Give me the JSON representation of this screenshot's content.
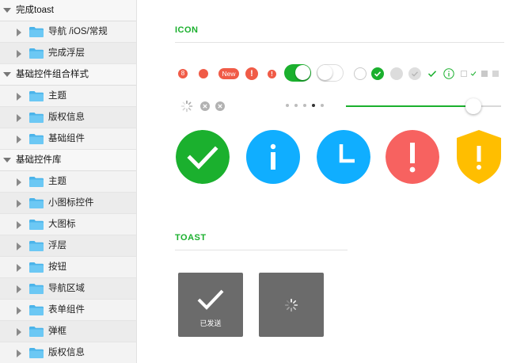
{
  "sidebar": {
    "groups": [
      {
        "label": "完成toast",
        "items": [
          "导航 /iOS/常规",
          "完成浮层"
        ]
      },
      {
        "label": "基础控件组合样式",
        "items": [
          "主题",
          "版权信息",
          "基础组件"
        ]
      },
      {
        "label": "基础控件库",
        "items": [
          "主题",
          "小图标控件",
          "大图标",
          "浮层",
          "按钮",
          "导航区域",
          "表单组件",
          "弹框",
          "版权信息"
        ]
      }
    ]
  },
  "main": {
    "icon_section": {
      "title": "ICON"
    },
    "badges": {
      "count": "8",
      "new_label": "New",
      "exclamation": "!"
    },
    "info_glyph": "i",
    "big_alert_glyph": "!",
    "toast_section": {
      "title": "TOAST"
    },
    "toast_sent": {
      "label": "已发送"
    },
    "slider": {
      "value": 0.82
    },
    "page_dots": {
      "count": 5,
      "active": 3
    }
  },
  "colors": {
    "accent_green": "#1bb02e",
    "info_blue": "#10aeff",
    "alert_red": "#f76260",
    "badge_red": "#f05b47",
    "warn_yellow": "#ffbe00",
    "toast_gray": "#6b6b6b"
  },
  "icons": [
    "triangle-down-icon",
    "triangle-right-icon",
    "folder-icon",
    "success-icon",
    "info-icon",
    "clock-icon",
    "alert-icon",
    "shield-warning-icon",
    "loading-icon",
    "clear-icon"
  ]
}
